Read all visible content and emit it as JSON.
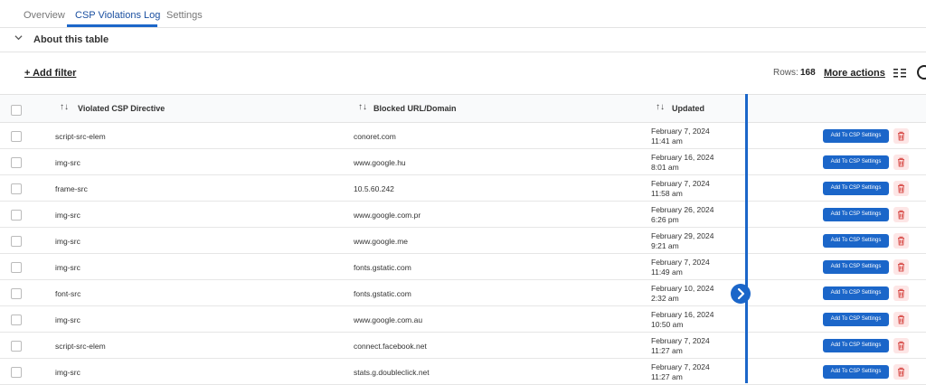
{
  "tabs": [
    {
      "label": "Overview"
    },
    {
      "label": "CSP Violations Log"
    },
    {
      "label": "Settings"
    }
  ],
  "about_label": "About this table",
  "toolbar": {
    "add_filter": "+ Add filter",
    "rows_label": "Rows:",
    "rows_count": "168",
    "more_actions": "More actions"
  },
  "columns": {
    "directive": "Violated CSP Directive",
    "blocked": "Blocked URL/Domain",
    "updated": "Updated"
  },
  "add_button_label": "Add To CSP Settings",
  "colors": {
    "accent": "#1b66c9",
    "delete": "#d9534f"
  },
  "rows": [
    {
      "directive": "script-src-elem",
      "blocked": "conoret.com",
      "date": "February 7, 2024",
      "time": "11:41 am"
    },
    {
      "directive": "img-src",
      "blocked": "www.google.hu",
      "date": "February 16, 2024",
      "time": "8:01 am"
    },
    {
      "directive": "frame-src",
      "blocked": "10.5.60.242",
      "date": "February 7, 2024",
      "time": "11:58 am"
    },
    {
      "directive": "img-src",
      "blocked": "www.google.com.pr",
      "date": "February 26, 2024",
      "time": "6:26 pm"
    },
    {
      "directive": "img-src",
      "blocked": "www.google.me",
      "date": "February 29, 2024",
      "time": "9:21 am"
    },
    {
      "directive": "img-src",
      "blocked": "fonts.gstatic.com",
      "date": "February 7, 2024",
      "time": "11:49 am"
    },
    {
      "directive": "font-src",
      "blocked": "fonts.gstatic.com",
      "date": "February 10, 2024",
      "time": "2:32 am"
    },
    {
      "directive": "img-src",
      "blocked": "www.google.com.au",
      "date": "February 16, 2024",
      "time": "10:50 am"
    },
    {
      "directive": "script-src-elem",
      "blocked": "connect.facebook.net",
      "date": "February 7, 2024",
      "time": "11:27 am"
    },
    {
      "directive": "img-src",
      "blocked": "stats.g.doubleclick.net",
      "date": "February 7, 2024",
      "time": "11:27 am"
    }
  ]
}
